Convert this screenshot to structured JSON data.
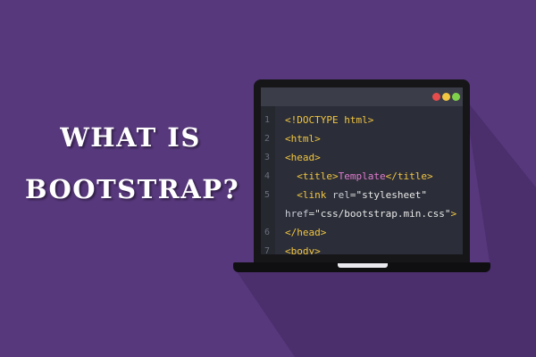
{
  "headline": {
    "line1": "WHAT IS",
    "line2": "BOOTSTRAP?"
  },
  "colors": {
    "background": "#57387c",
    "shadow": "#4a2f6c",
    "dot_red": "#e74c4c",
    "dot_yellow": "#f2c542",
    "dot_green": "#7fd14b"
  },
  "editor": {
    "lines": [
      {
        "number": "1",
        "parts": [
          {
            "t": "<!DOCTYPE html>",
            "c": "tag"
          }
        ]
      },
      {
        "number": "2",
        "parts": [
          {
            "t": "<html>",
            "c": "tag"
          }
        ]
      },
      {
        "number": "3",
        "parts": [
          {
            "t": "<head>",
            "c": "tag"
          }
        ]
      },
      {
        "number": "4",
        "parts": [
          {
            "t": "  <title>",
            "c": "tag"
          },
          {
            "t": "Template",
            "c": "text"
          },
          {
            "t": "</title>",
            "c": "tag"
          }
        ]
      },
      {
        "number": "5",
        "parts": [
          {
            "t": "  <link ",
            "c": "tag"
          },
          {
            "t": "rel",
            "c": "attr"
          },
          {
            "t": "=",
            "c": "plain"
          },
          {
            "t": "\"stylesheet\"",
            "c": "str"
          }
        ]
      },
      {
        "number": "",
        "parts": [
          {
            "t": "href",
            "c": "attr"
          },
          {
            "t": "=",
            "c": "plain"
          },
          {
            "t": "\"css/bootstrap.min.css\"",
            "c": "str"
          },
          {
            "t": ">",
            "c": "tag"
          }
        ]
      },
      {
        "number": "6",
        "parts": [
          {
            "t": "</head>",
            "c": "tag"
          }
        ]
      },
      {
        "number": "7",
        "parts": [
          {
            "t": "<body>",
            "c": "tag"
          }
        ]
      }
    ]
  }
}
